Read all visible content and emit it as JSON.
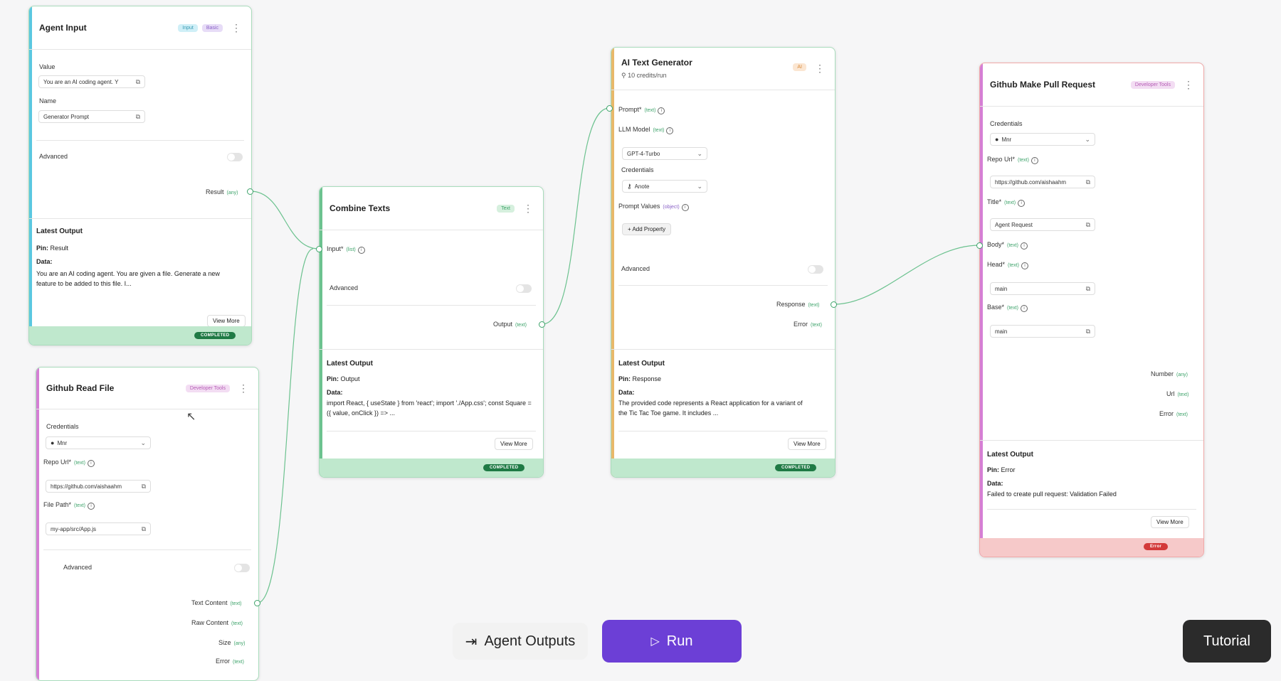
{
  "colors": {
    "accent_green": "#3da36a",
    "status_green": "#1f7a45",
    "status_red": "#d33a3a",
    "run_purple": "#6c3fd6",
    "tutorial_dark": "#2b2b2b"
  },
  "nodes": {
    "agent_input": {
      "title": "Agent Input",
      "badges": [
        "Input",
        "Basic"
      ],
      "value_label": "Value",
      "value": "You are an AI coding agent. Y",
      "name_label": "Name",
      "name": "Generator Prompt",
      "advanced_label": "Advanced",
      "result_label": "Result",
      "result_tag": "(any)",
      "latest_output_label": "Latest Output",
      "pin_label": "Pin:",
      "pin": "Result",
      "data_label": "Data:",
      "data": "You are an AI coding agent. You are given a file. Generate a new feature to be added to this file. I...",
      "view_more": "View More",
      "status": "COMPLETED"
    },
    "github_read_file": {
      "title": "Github Read File",
      "badge": "Developer Tools",
      "credentials_label": "Credentials",
      "credentials": "Mnr",
      "repo_label": "Repo Url*",
      "repo_tag": "(text)",
      "repo": "https://github.com/aishaahm",
      "path_label": "File Path*",
      "path_tag": "(text)",
      "path": "my-app/src/App.js",
      "advanced_label": "Advanced",
      "outputs": [
        {
          "label": "Text Content",
          "tag": "(text)"
        },
        {
          "label": "Raw Content",
          "tag": "(text)"
        },
        {
          "label": "Size",
          "tag": "(any)"
        },
        {
          "label": "Error",
          "tag": "(text)"
        }
      ]
    },
    "combine_texts": {
      "title": "Combine Texts",
      "badge": "Text",
      "input_label": "Input*",
      "input_tag": "(list)",
      "advanced_label": "Advanced",
      "output_label": "Output",
      "output_tag": "(text)",
      "latest_output_label": "Latest Output",
      "pin_label": "Pin:",
      "pin": "Output",
      "data_label": "Data:",
      "data": "import React, { useState } from 'react'; import './App.css'; const Square = ({ value, onClick }) => ...",
      "view_more": "View More",
      "status": "COMPLETED"
    },
    "ai_text_generator": {
      "title": "AI Text Generator",
      "badge": "AI",
      "credits": "10 credits/run",
      "prompt_label": "Prompt*",
      "prompt_tag": "(text)",
      "model_label": "LLM Model",
      "model_tag": "(text)",
      "model": "GPT-4-Turbo",
      "credentials_label": "Credentials",
      "credentials": "Anote",
      "prompt_values_label": "Prompt Values",
      "prompt_values_tag": "(object)",
      "add_property": "Add Property",
      "advanced_label": "Advanced",
      "response_label": "Response",
      "response_tag": "(text)",
      "error_label": "Error",
      "error_tag": "(text)",
      "latest_output_label": "Latest Output",
      "pin_label": "Pin:",
      "pin": "Response",
      "data_label": "Data:",
      "data": "The provided code represents a React application for a variant of the Tic Tac Toe game. It includes ...",
      "view_more": "View More",
      "status": "COMPLETED"
    },
    "github_pr": {
      "title": "Github Make Pull Request",
      "badge": "Developer Tools",
      "credentials_label": "Credentials",
      "credentials": "Mnr",
      "repo_label": "Repo Url*",
      "repo_tag": "(text)",
      "repo": "https://github.com/aishaahm",
      "title_label": "Title*",
      "title_tag": "(text)",
      "title_value": "Agent Request",
      "body_label": "Body*",
      "body_tag": "(text)",
      "head_label": "Head*",
      "head_tag": "(text)",
      "head": "main",
      "base_label": "Base*",
      "base_tag": "(text)",
      "base": "main",
      "outputs": [
        {
          "label": "Number",
          "tag": "(any)"
        },
        {
          "label": "Url",
          "tag": "(text)"
        },
        {
          "label": "Error",
          "tag": "(text)"
        }
      ],
      "latest_output_label": "Latest Output",
      "pin_label": "Pin:",
      "pin": "Error",
      "data_label": "Data:",
      "data": "Failed to create pull request: Validation Failed",
      "view_more": "View More",
      "status": "Error"
    }
  },
  "bottom": {
    "agent_outputs": "Agent Outputs",
    "run": "Run",
    "tutorial": "Tutorial"
  }
}
